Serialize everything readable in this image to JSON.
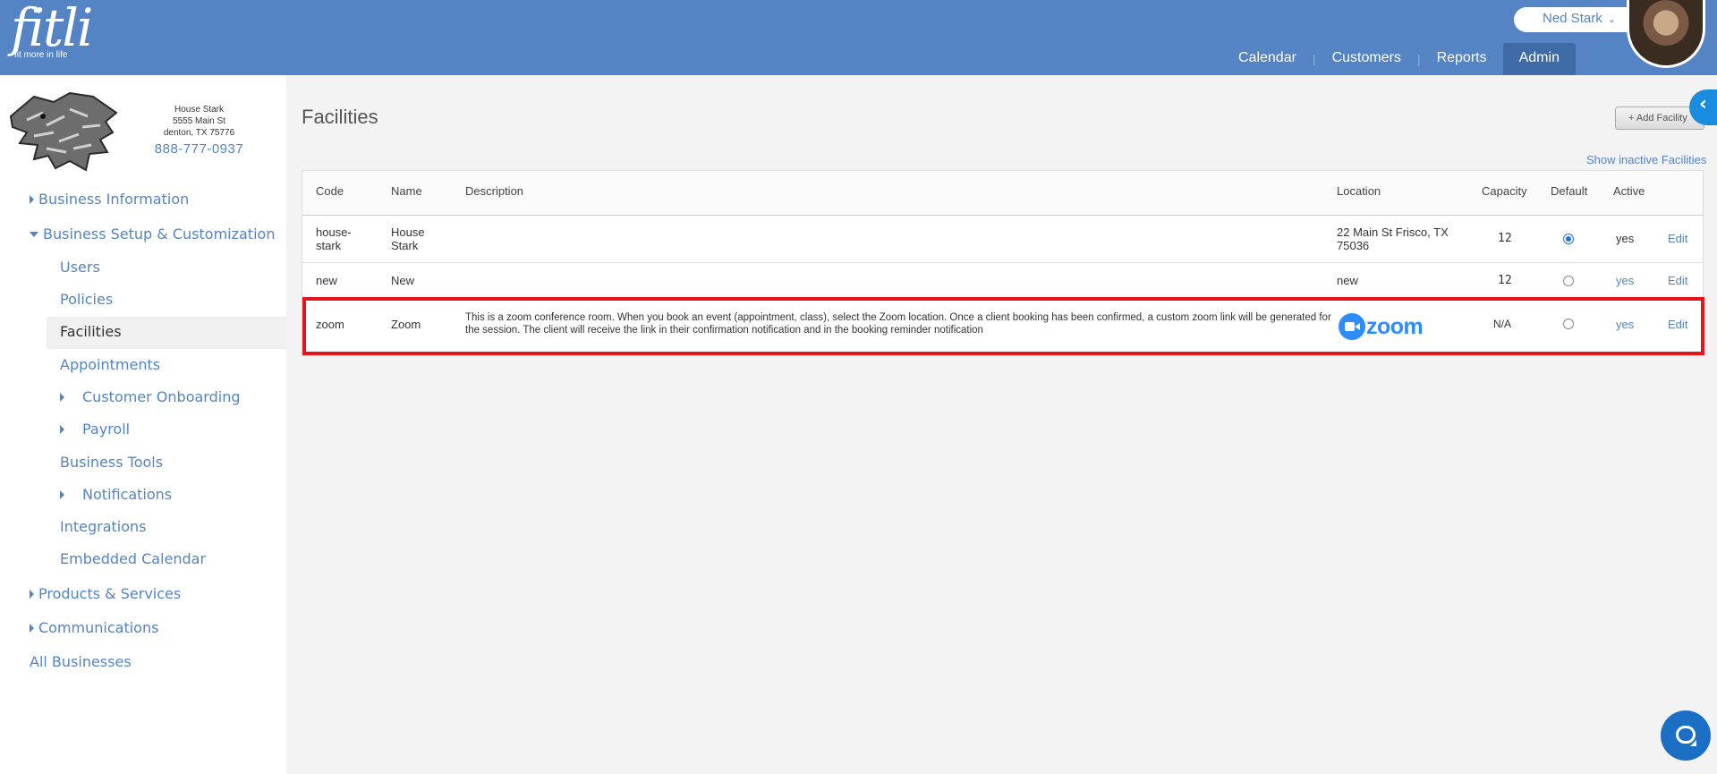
{
  "app": {
    "logo_text": "fitli",
    "tagline": "fit more in life"
  },
  "header": {
    "user_name": "Ned Stark",
    "nav": [
      {
        "label": "Calendar"
      },
      {
        "label": "Customers"
      },
      {
        "label": "Reports"
      },
      {
        "label": "Admin",
        "active": true
      }
    ]
  },
  "business": {
    "name": "House Stark",
    "street": "5555 Main St",
    "city": "denton, TX 75776",
    "phone": "888-777-0937"
  },
  "sidebar": {
    "items": [
      {
        "label": "Business Information"
      },
      {
        "label": "Business Setup & Customization"
      },
      {
        "label": "Users"
      },
      {
        "label": "Policies"
      },
      {
        "label": "Facilities",
        "active": true
      },
      {
        "label": "Appointments"
      },
      {
        "label": "Customer Onboarding"
      },
      {
        "label": "Payroll"
      },
      {
        "label": "Business Tools"
      },
      {
        "label": "Notifications"
      },
      {
        "label": "Integrations"
      },
      {
        "label": "Embedded Calendar"
      },
      {
        "label": "Products & Services"
      },
      {
        "label": "Communications"
      },
      {
        "label": "All Businesses"
      }
    ]
  },
  "page": {
    "title": "Facilities",
    "add_button": "+ Add Facility",
    "show_inactive": "Show inactive Facilities"
  },
  "table": {
    "columns": [
      "Code",
      "Name",
      "Description",
      "Location",
      "Capacity",
      "Default",
      "Active"
    ],
    "rows": [
      {
        "code": "house-stark",
        "name": "House Stark",
        "description": "",
        "location": "22 Main St Frisco, TX 75036",
        "capacity": "12",
        "default": true,
        "active": "yes",
        "edit": "Edit"
      },
      {
        "code": "new",
        "name": "New",
        "description": "",
        "location": "new",
        "capacity": "12",
        "default": false,
        "active": "yes",
        "edit": "Edit"
      },
      {
        "code": "zoom",
        "name": "Zoom",
        "description": "This is a zoom conference room. When you book an event (appointment, class), select the Zoom location. Once a client booking has been confirmed, a custom zoom link will be generated for the session. The client will receive the link in their confirmation notification and in the booking reminder notification",
        "location_logo_text": "zoom",
        "capacity": "N/A",
        "default": false,
        "active": "yes",
        "edit": "Edit"
      }
    ]
  },
  "colors": {
    "header": "#5484c3",
    "link": "#5484c3",
    "highlight": "#e3141b",
    "zoom": "#2d8cff"
  }
}
